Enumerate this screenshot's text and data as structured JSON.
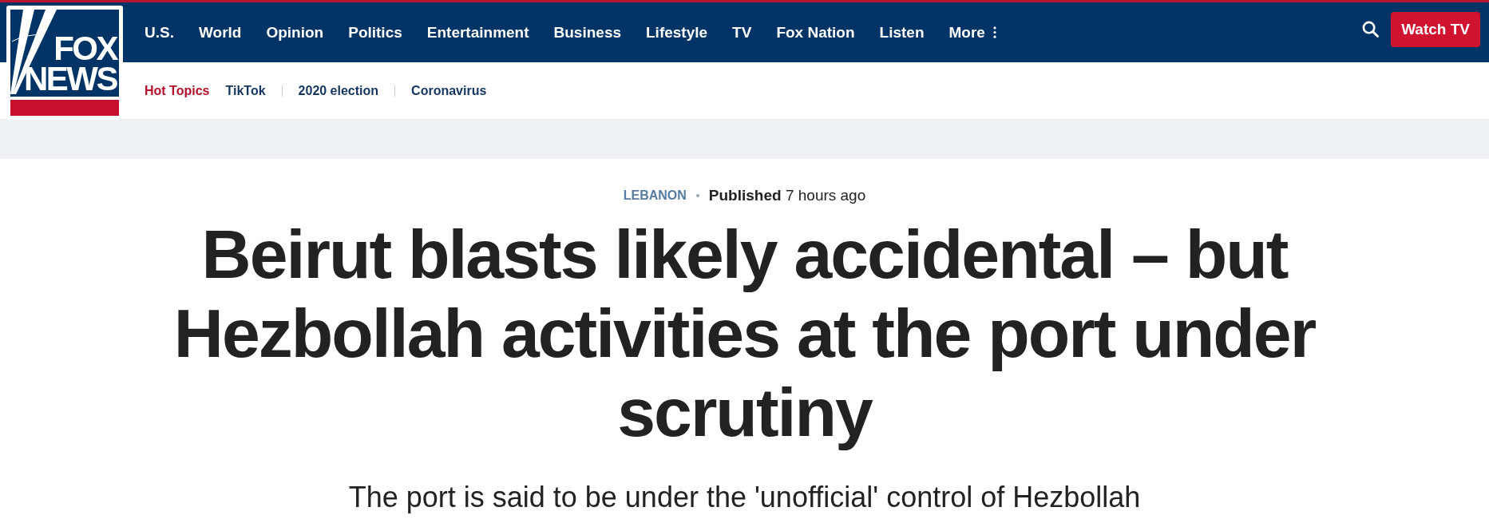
{
  "logo": {
    "lines": [
      "FOX",
      "NEWS"
    ]
  },
  "main_nav": {
    "items": [
      "U.S.",
      "World",
      "Opinion",
      "Politics",
      "Entertainment",
      "Business",
      "Lifestyle",
      "TV",
      "Fox Nation",
      "Listen"
    ],
    "more": "More",
    "watch_button": "Watch TV"
  },
  "sub_nav": {
    "label": "Hot Topics",
    "topics": [
      "TikTok",
      "2020 election",
      "Coronavirus"
    ]
  },
  "article": {
    "category": "LEBANON",
    "published": "**Published** 7 hours ago",
    "headline": "Beirut blasts likely accidental – but Hezbollah activities at the port under scrutiny",
    "subheadline": "The port is said to be under the 'unofficial' control of Hezbollah"
  }
}
